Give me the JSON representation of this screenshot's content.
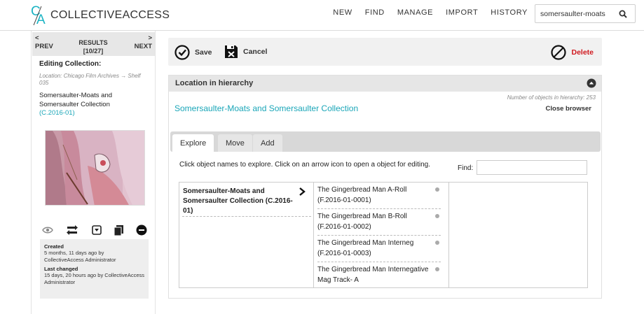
{
  "header": {
    "logo_text": "COLLECTIVEACCESS",
    "logo_letters": {
      "c": "C",
      "a": "A"
    },
    "nav": [
      "NEW",
      "FIND",
      "MANAGE",
      "IMPORT",
      "HISTORY"
    ],
    "search_value": "somersaulter-moats",
    "search_icon": "search-icon"
  },
  "sidebar": {
    "prev_arrow": "<",
    "prev_label": "PREV",
    "next_arrow": ">",
    "next_label": "NEXT",
    "results_label": "RESULTS",
    "results_count": "[10/27]",
    "editing_label": "Editing Collection:",
    "location_line": "Location: Chicago Film Archives → Shelf 035",
    "collection_title": "Somersaulter-Moats and Somersaulter Collection",
    "collection_id": "(C.2016-01)",
    "tool_icons": [
      "eye-icon",
      "swap-icon",
      "dropdown-icon",
      "duplicate-icon",
      "remove-icon"
    ],
    "created_label": "Created",
    "created_value": "5 months, 11 days ago by CollectiveAccess Administrator",
    "changed_label": "Last changed",
    "changed_value": "15 days, 20 hours ago by CollectiveAccess Administrator"
  },
  "toolbar": {
    "save_label": "Save",
    "cancel_label": "Cancel",
    "delete_label": "Delete",
    "delete_color": "#d0191f"
  },
  "hierarchy": {
    "title": "Location in hierarchy",
    "count_text": "Number of objects in hierarchy: 253",
    "close_label": "Close browser",
    "link_text": "Somersaulter-Moats and Somersaulter Collection",
    "tabs": [
      "Explore",
      "Move",
      "Add"
    ],
    "help_text": "Click object names to explore. Click on an arrow icon to open a object for editing.",
    "find_label": "Find:",
    "find_value": "",
    "column1_item": "Somersaulter-Moats and Somersaulter Collection (C.2016-01)",
    "column2_items": [
      "The Gingerbread Man A-Roll (F.2016-01-0001)",
      "The Gingerbread Man B-Roll (F.2016-01-0002)",
      "The Gingerbread Man Interneg (F.2016-01-0003)",
      "The Gingerbread Man Internegative Mag Track- A"
    ]
  },
  "colors": {
    "accent": "#1aa6b8",
    "panel_header": "#e6e6e6"
  }
}
